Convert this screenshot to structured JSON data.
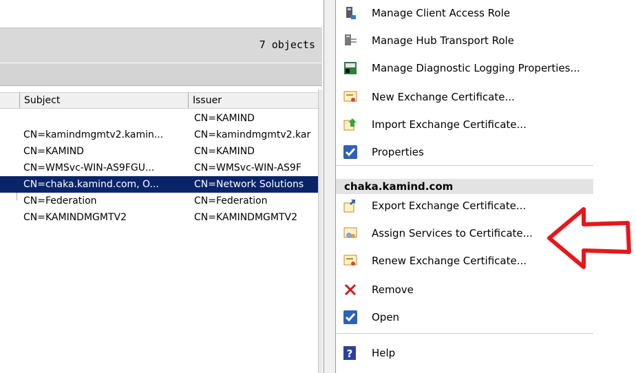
{
  "list": {
    "object_count": "7 objects",
    "columns": {
      "subject": "Subject",
      "issuer": "Issuer"
    },
    "rows": [
      {
        "subject": "",
        "issuer": "CN=KAMIND"
      },
      {
        "subject": "CN=kamindmgmtv2.kamin...",
        "issuer": "CN=kamindmgmtv2.kar"
      },
      {
        "subject": "CN=KAMIND",
        "issuer": "CN=KAMIND"
      },
      {
        "subject": "CN=WMSvc-WIN-AS9FGU...",
        "issuer": "CN=WMSvc-WIN-AS9F"
      },
      {
        "subject": "CN=chaka.kamind.com, O...",
        "issuer": "CN=Network Solutions"
      },
      {
        "subject": "CN=Federation",
        "issuer": "CN=Federation"
      },
      {
        "subject": "CN=KAMINDMGMTV2",
        "issuer": "CN=KAMINDMGMTV2"
      }
    ],
    "selected_index": 4
  },
  "actions": {
    "server_actions": [
      {
        "label": "Manage Client Access Role",
        "icon": "client-access-role-icon"
      },
      {
        "label": "Manage Hub Transport Role",
        "icon": "hub-transport-role-icon"
      },
      {
        "label": "Manage Diagnostic Logging Properties...",
        "icon": "diagnostic-logging-icon"
      },
      {
        "label": "New Exchange Certificate...",
        "icon": "new-certificate-icon"
      },
      {
        "label": "Import Exchange Certificate...",
        "icon": "import-certificate-icon"
      },
      {
        "label": "Properties",
        "icon": "properties-checkbox-icon"
      }
    ],
    "group_header": "chaka.kamind.com",
    "certificate_actions": [
      {
        "label": "Export Exchange Certificate...",
        "icon": "export-certificate-icon"
      },
      {
        "label": "Assign Services to Certificate...",
        "icon": "assign-services-icon"
      },
      {
        "label": "Renew Exchange Certificate...",
        "icon": "renew-certificate-icon"
      },
      {
        "label": "Remove",
        "icon": "remove-x-icon"
      },
      {
        "label": "Open",
        "icon": "open-checkbox-icon"
      }
    ],
    "help": {
      "label": "Help",
      "icon": "help-icon"
    }
  },
  "colors": {
    "selection": "#0a246a",
    "arrow": "#e8161b",
    "status_bar": "#d9d9d9"
  }
}
